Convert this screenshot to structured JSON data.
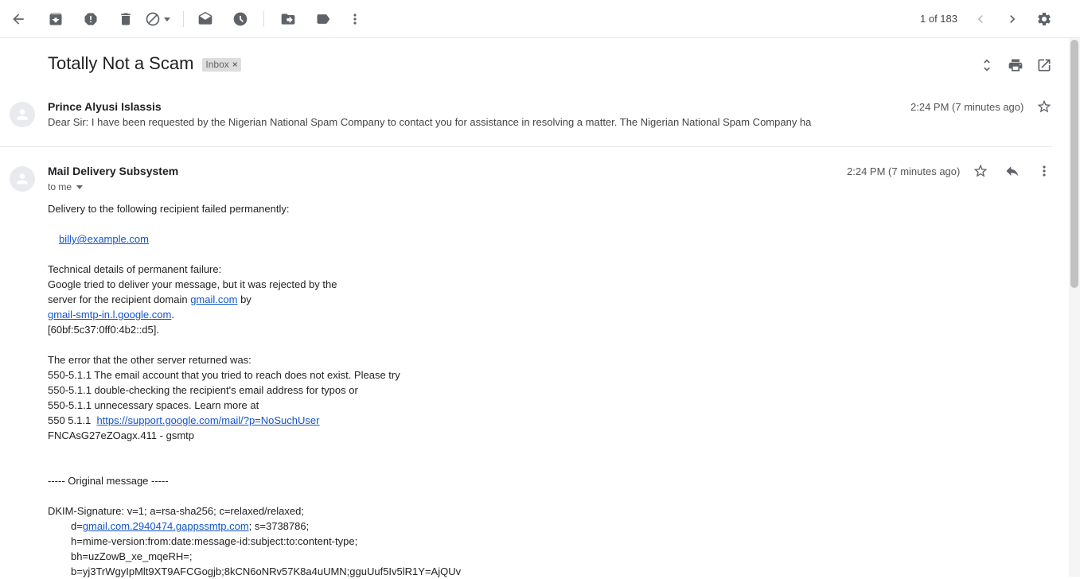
{
  "toolbar": {
    "back": "back-icon",
    "archive": "archive-icon",
    "report_spam": "report-spam-icon",
    "delete": "delete-icon",
    "block": "block-icon",
    "mark_unread": "mark-unread-icon",
    "snooze": "snooze-icon",
    "move_to": "move-to-icon",
    "labels": "label-icon",
    "more": "more-vert-icon",
    "pager": "1 of 183",
    "settings": "gear-icon"
  },
  "thread": {
    "subject": "Totally Not a Scam",
    "label": "Inbox",
    "label_remove": "×"
  },
  "messages": [
    {
      "sender": "Prince Alyusi Islassis",
      "time": "2:24 PM (7 minutes ago)",
      "snippet": "Dear Sir: I have been requested by the Nigerian National Spam Company to contact you for assistance in resolving a matter. The Nigerian National Spam Company ha",
      "collapsed": true
    },
    {
      "sender": "Mail Delivery Subsystem",
      "time": "2:24 PM (7 minutes ago)",
      "to": "to me",
      "collapsed": false,
      "body": {
        "l1": "Delivery to the following recipient failed permanently:",
        "recipient": "billy@example.com",
        "l3": "Technical details of permanent failure:",
        "l4": "Google tried to deliver your message, but it was rejected by the",
        "l5a": "server for the recipient domain ",
        "l5link": "gmail.com",
        "l5b": " by",
        "l6link": "gmail-smtp-in.l.google.com",
        "l6b": ".",
        "l7": "[60bf:5c37:0ff0:4b2::d5].",
        "l8": "The error that the other server returned was:",
        "l9": "550-5.1.1 The email account that you tried to reach does not exist. Please try",
        "l10": "550-5.1.1 double-checking the recipient's email address for typos or",
        "l11": "550-5.1.1 unnecessary spaces. Learn more at",
        "l12a": "550 5.1.1  ",
        "l12link": "https://support.google.com/mail/?p=NoSuchUser",
        "l13": "FNCAsG27eZOagx.411 - gsmtp",
        "l14": "----- Original message -----",
        "l15": "DKIM-Signature: v=1; a=rsa-sha256; c=relaxed/relaxed;",
        "l16a": "d=",
        "l16link": "gmail.com.2940474.gappssmtp.com",
        "l16b": "; s=3738786;",
        "l17": "h=mime-version:from:date:message-id:subject:to:content-type;",
        "l18": "bh=uzZowB_xe_mqeRH=;",
        "l19": "b=yj3TrWgyIpMlt9XT9AFCGogjb;8kCN6oNRv57K8a4uUMN;gguUuf5Iv5lR1Y=AjQUv"
      }
    }
  ],
  "icons": {
    "expand_all": "unfold-icon",
    "print": "print-icon",
    "new_window": "open-in-new-icon",
    "star": "star-icon",
    "reply": "reply-icon",
    "more": "more-vert-icon",
    "avatar": "person-icon"
  }
}
